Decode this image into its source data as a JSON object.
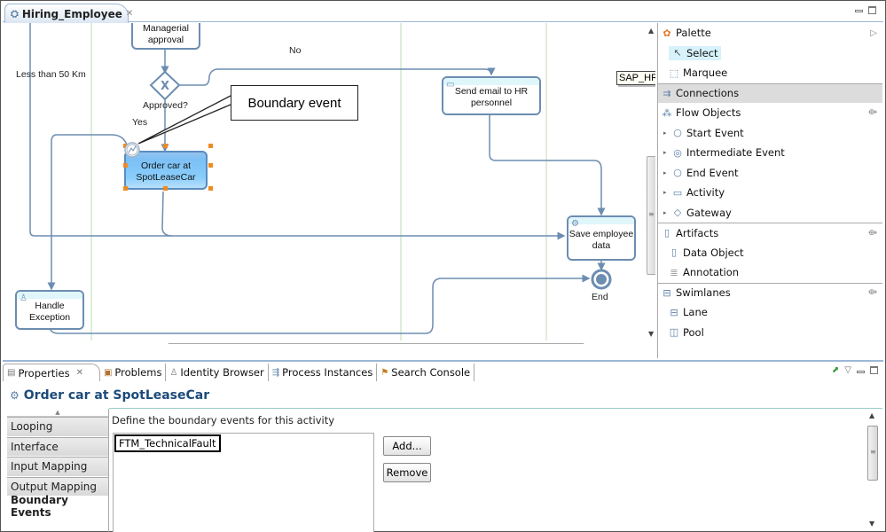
{
  "editor": {
    "tab_title": "Hiring_Employee",
    "tab_close": "✕"
  },
  "diagram": {
    "nodes": {
      "managerial_approval": "Managerial approval",
      "order_car": "Order car at SpotLeaseCar",
      "send_email": "Send email to HR personnel",
      "save_employee": "Save employee data",
      "handle_exception": "Handle Exception"
    },
    "gateway_label": "Approved?",
    "gateway_symbol": "X",
    "end_label": "End",
    "flow_labels": {
      "no": "No",
      "yes": "Yes",
      "less_than": "Less than 50 Km"
    },
    "callout": "Boundary event",
    "lane_tag": "SAP_HR",
    "scroll_grip": "III"
  },
  "palette": {
    "title": "Palette",
    "tools": [
      "Select",
      "Marquee"
    ],
    "connections": "Connections",
    "flow_objects": {
      "label": "Flow Objects",
      "items": [
        "Start Event",
        "Intermediate Event",
        "End Event",
        "Activity",
        "Gateway"
      ]
    },
    "artifacts": {
      "label": "Artifacts",
      "items": [
        "Data Object",
        "Annotation"
      ]
    },
    "swimlanes": {
      "label": "Swimlanes",
      "items": [
        "Lane",
        "Pool"
      ]
    }
  },
  "bottom": {
    "tabs": [
      "Properties",
      "Problems",
      "Identity Browser",
      "Process Instances",
      "Search Console"
    ],
    "active_tab": "Properties",
    "title": "Order car at SpotLeaseCar",
    "side_tabs": [
      "Looping",
      "Interface",
      "Input Mapping",
      "Output Mapping",
      "Boundary Events"
    ],
    "active_side_tab": "Boundary Events",
    "description": "Define the boundary events for this activity",
    "boundary_events": [
      "FTM_TechnicalFault"
    ],
    "buttons": {
      "add": "Add...",
      "remove": "Remove"
    }
  },
  "colors": {
    "flow_line": "#6c8db0",
    "selection_handle": "#f08a20",
    "lane_divider": "#b9dcb0",
    "title_text": "#1c4a7a"
  }
}
